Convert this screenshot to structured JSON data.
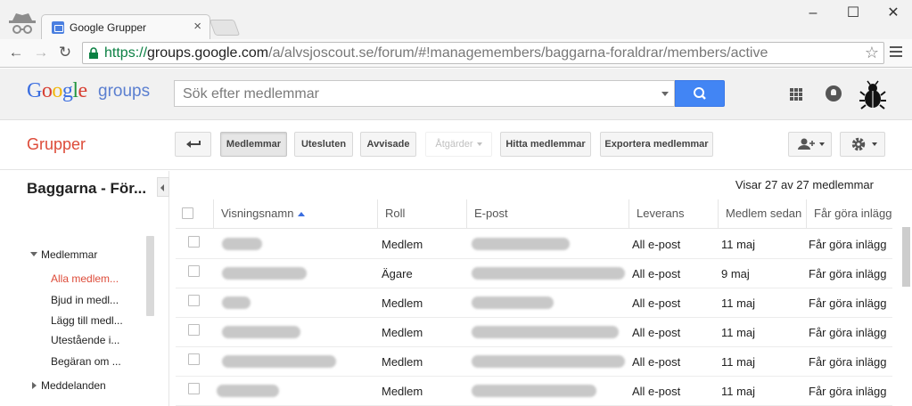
{
  "browser": {
    "tab_title": "Google Grupper",
    "url_scheme": "https://",
    "url_host": "groups.google.com",
    "url_path": "/a/alvsjoscout.se/forum/#!managemembers/baggarna-foraldrar/members/active",
    "icons": [
      "incognito-icon",
      "back-icon",
      "forward-icon",
      "reload-icon",
      "lock-icon",
      "bookmark-star-icon",
      "chrome-menu-icon"
    ]
  },
  "header": {
    "logo": "Google",
    "logo_suffix": "groups",
    "search_placeholder": "Sök efter medlemmar"
  },
  "toolbar": {
    "section_title": "Grupper",
    "buttons": {
      "members": "Medlemmar",
      "excluded": "Utesluten",
      "rejected": "Avvisade",
      "actions": "Åtgärder",
      "find_members": "Hitta medlemmar",
      "export_members": "Exportera medlemmar"
    }
  },
  "sidebar": {
    "group_name": "Baggarna - För...",
    "members_label": "Medlemmar",
    "items": [
      "Alla medlem...",
      "Bjud in medl...",
      "Lägg till medl...",
      "Utestående i...",
      "Begäran om ..."
    ],
    "messages_label": "Meddelanden"
  },
  "table": {
    "count_text": "Visar 27 av 27 medlemmar",
    "columns": [
      "Visningsnamn",
      "Roll",
      "E-post",
      "Leverans",
      "Medlem sedan",
      "Får göra inlägg"
    ],
    "rows": [
      {
        "role": "Medlem",
        "delivery": "All e-post",
        "since": "11 maj",
        "posting": "Får göra inlägg"
      },
      {
        "role": "Ägare",
        "delivery": "All e-post",
        "since": "9 maj",
        "posting": "Får göra inlägg"
      },
      {
        "role": "Medlem",
        "delivery": "All e-post",
        "since": "11 maj",
        "posting": "Får göra inlägg"
      },
      {
        "role": "Medlem",
        "delivery": "All e-post",
        "since": "11 maj",
        "posting": "Får göra inlägg"
      },
      {
        "role": "Medlem",
        "delivery": "All e-post",
        "since": "11 maj",
        "posting": "Får göra inlägg"
      },
      {
        "role": "Medlem",
        "delivery": "All e-post",
        "since": "11 maj",
        "posting": "Får göra inlägg"
      }
    ]
  },
  "colors": {
    "accent_red": "#dd4b39",
    "search_blue": "#4285f4",
    "secure_green": "#0b8043"
  }
}
